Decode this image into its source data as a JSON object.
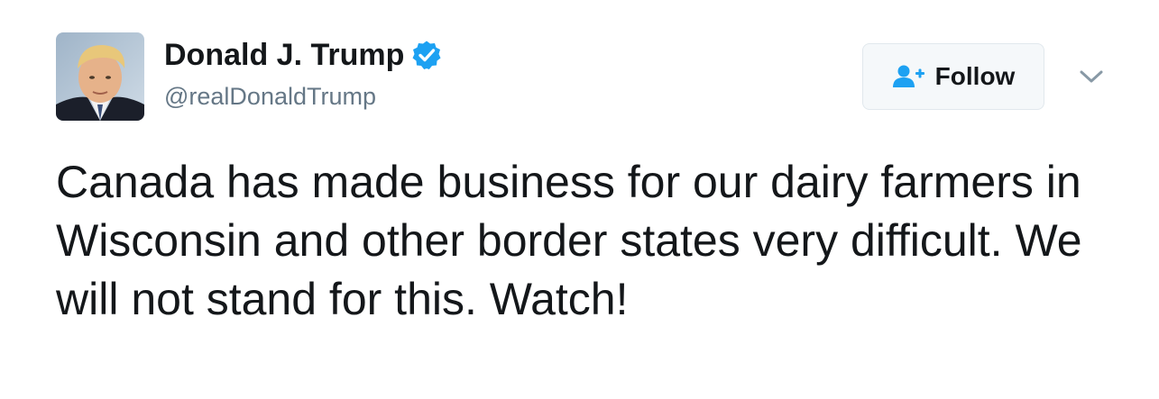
{
  "user": {
    "display_name": "Donald J. Trump",
    "handle": "@realDonaldTrump",
    "verified": true,
    "avatar_icon": "profile-photo"
  },
  "actions": {
    "follow_label": "Follow",
    "follow_icon": "add-user-icon",
    "more_icon": "chevron-down-icon"
  },
  "tweet": {
    "text": "Canada has made business for our dairy farmers in Wisconsin and other border states very difficult. We will not stand for this. Watch!"
  },
  "colors": {
    "text": "#14171a",
    "secondary": "#657786",
    "brand_blue": "#1da1f2",
    "button_bg": "#f5f8fa",
    "button_border": "#e1e8ed"
  }
}
